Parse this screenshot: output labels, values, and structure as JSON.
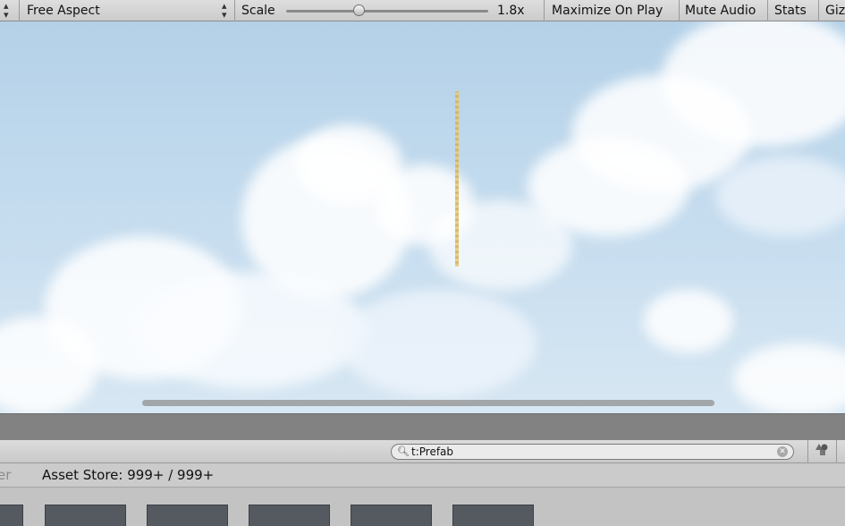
{
  "toolbar": {
    "aspect_label": "Free Aspect",
    "scale_label": "Scale",
    "scale_value": "1.8x",
    "scale_fraction": 0.36,
    "maximize_label": "Maximize On Play",
    "mute_label": "Mute Audio",
    "stats_label": "Stats",
    "gizmos_label": "Giz"
  },
  "project": {
    "search_value": "t:Prefab",
    "partial_label": "er",
    "asset_store_label": "Asset Store: 999+ / 999+"
  },
  "icons": {
    "dropdown": "updown-arrow-icon",
    "search": "magnifier-icon",
    "clear": "clear-circle-icon",
    "filter": "shapes-filter-icon"
  },
  "colors": {
    "sky": "#c3dbee",
    "toolbar": "#d4d4d4",
    "thumbnail": "#555a60"
  }
}
